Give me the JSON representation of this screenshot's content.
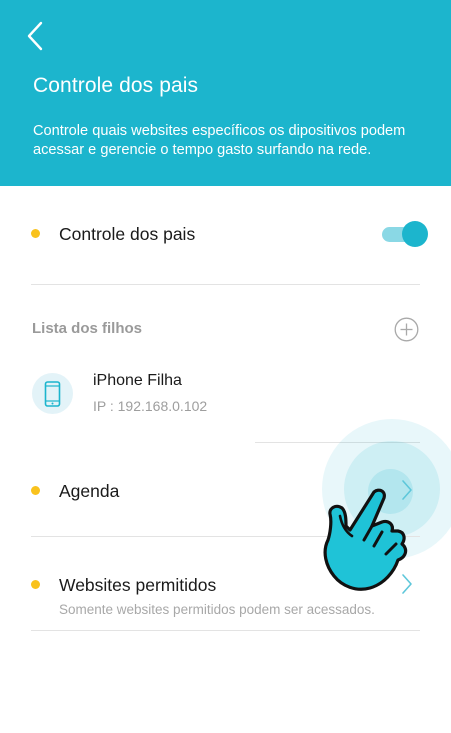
{
  "header": {
    "title": "Controle dos pais",
    "description": "Controle quais websites específicos os dipositivos podem acessar e gerencie o tempo gasto surfando na rede.",
    "back_icon": "chevron-left-icon",
    "background_color": "#1cb5cd"
  },
  "parental_control": {
    "label": "Controle dos pais",
    "toggle_state": "on",
    "accent_color": "#1cb5cd"
  },
  "children_list": {
    "title": "Lista dos filhos",
    "add_icon": "plus-circle-icon",
    "devices": [
      {
        "name": "iPhone Filha",
        "ip": "IP : 192.168.0.102",
        "icon": "phone-icon"
      }
    ]
  },
  "menu": {
    "schedule": {
      "label": "Agenda",
      "icon": "chevron-right-icon"
    },
    "allowed_sites": {
      "label": "Websites permitidos",
      "description": "Somente websites permitidos podem ser acessados.",
      "icon": "chevron-right-icon"
    }
  },
  "overlay": {
    "icon": "tap-hand-icon",
    "status_dot_color": "#f9c21d"
  }
}
